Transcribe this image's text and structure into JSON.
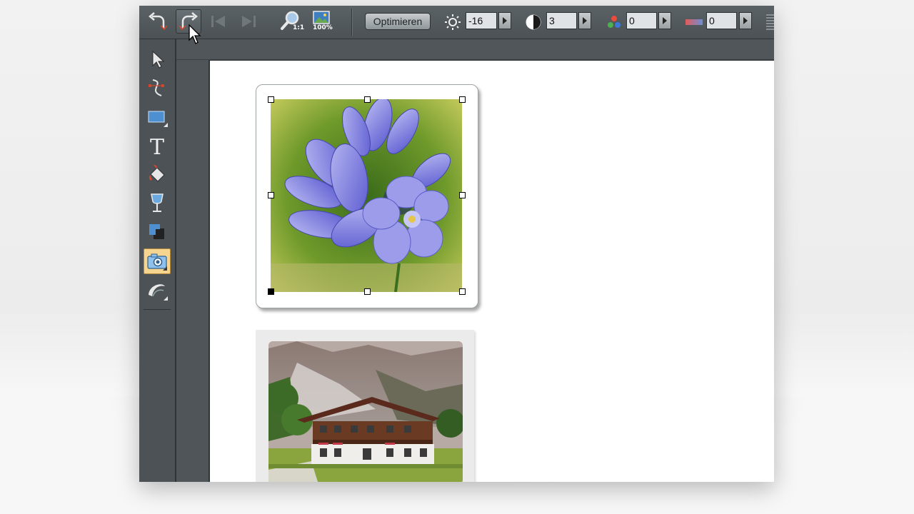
{
  "toolbar": {
    "optimize_label": "Optimieren",
    "zoom_1to1_label": "1:1",
    "zoom_fit_label": "100%",
    "brightness_value": "-16",
    "contrast_value": "3",
    "saturation_value": "0",
    "temperature_value": "0",
    "icons": [
      "undo-icon",
      "redo-icon",
      "first-frame-icon",
      "last-frame-icon",
      "zoom-1to1-icon",
      "zoom-100-icon",
      "brightness-icon",
      "contrast-icon",
      "saturation-icon",
      "temperature-icon"
    ]
  },
  "toolbox": {
    "tools": [
      "selector-tool",
      "bezier-tool",
      "rectangle-tool",
      "text-tool",
      "fill-tool",
      "transparency-tool",
      "shadow-tool",
      "photo-tool",
      "brush-tool"
    ],
    "active_tool": "photo-tool"
  },
  "colors": {
    "ui_dark": "#4a5054",
    "active_tool": "#f5d590",
    "page": "#ffffff"
  }
}
